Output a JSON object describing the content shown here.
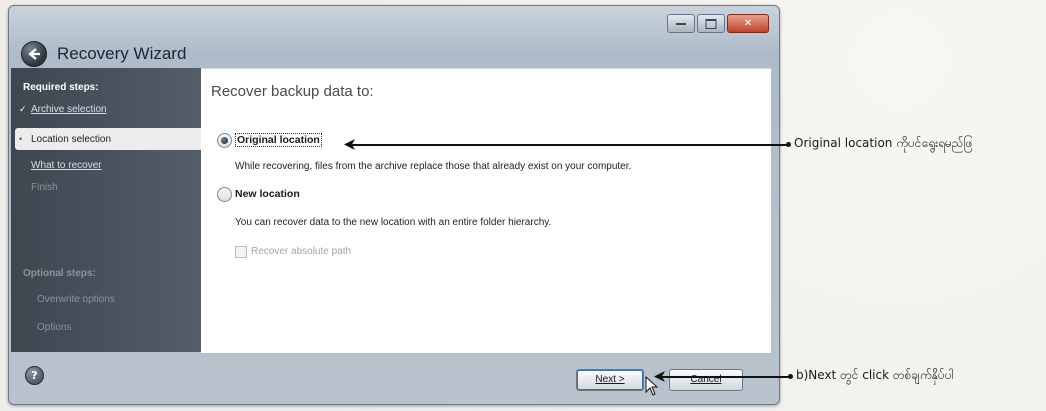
{
  "window": {
    "title": "Recovery Wizard"
  },
  "sidebar": {
    "required_heading": "Required steps:",
    "items": [
      {
        "label": "Archive selection",
        "mark": "✓"
      },
      {
        "label": "Location selection",
        "mark": "•"
      },
      {
        "label": "What to recover",
        "mark": ""
      },
      {
        "label": "Finish",
        "mark": ""
      }
    ],
    "optional_heading": "Optional steps:",
    "optional_items": [
      {
        "label": "Overwrite options"
      },
      {
        "label": "Options"
      }
    ]
  },
  "content": {
    "heading": "Recover backup data to:",
    "options": [
      {
        "label": "Original location",
        "selected": true,
        "description": "While recovering, files from the archive replace those that already exist on your computer."
      },
      {
        "label": "New location",
        "selected": false,
        "description": "You can recover data to the new location with an entire folder hierarchy."
      }
    ],
    "checkbox_label": "Recover absolute path"
  },
  "buttons": {
    "next": "Next >",
    "cancel": "Cancel"
  },
  "annotations": {
    "original": "Original location ကိုပင်ရွေးရမည်ဖြ",
    "next": "b)Next တွင် click တစ်ချက်နှိပ်ပါ"
  },
  "colors": {
    "sidebar": "#4a525c",
    "active_item": "#ececec",
    "close_button": "#c0432a"
  }
}
